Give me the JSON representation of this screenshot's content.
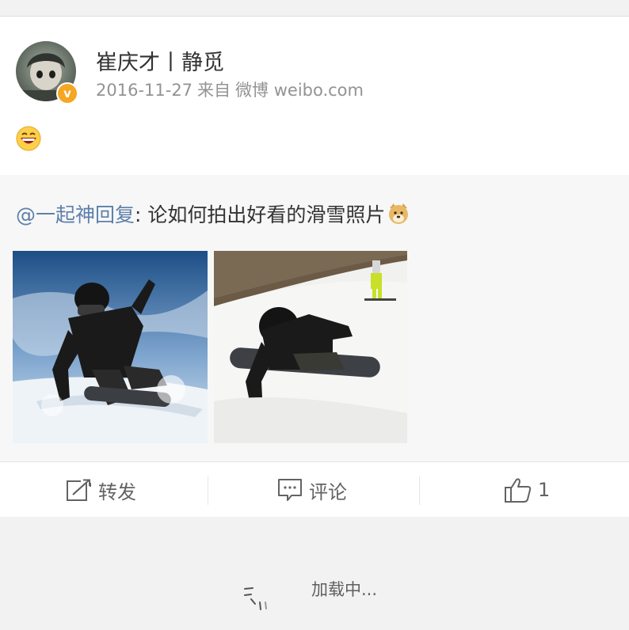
{
  "post": {
    "user_name": "崔庆才丨静觅",
    "date": "2016-11-27",
    "source_prefix": "来自",
    "source": "微博 weibo.com",
    "avatar": "avatar-icon",
    "verified_icon": "verified-v-icon",
    "verified_mark": "v",
    "content_emoji": "grinning-face-emoji"
  },
  "retweet": {
    "mention": "@一起神回复",
    "separator": ": ",
    "text": "论如何拍出好看的滑雪照片",
    "emoji": "doge-emoji",
    "images": [
      "snowboarder-photo-1",
      "snowboarder-photo-2"
    ]
  },
  "actions": {
    "repost_label": "转发",
    "comment_label": "评论",
    "like_count": "1",
    "repost_icon": "repost-icon",
    "comment_icon": "comment-icon",
    "like_icon": "thumbs-up-icon"
  },
  "loading": {
    "text": "加载中..."
  },
  "colors": {
    "link": "#5d80ab",
    "text": "#333333",
    "meta": "#939393",
    "verified": "#f5a623",
    "page_bg": "#f2f2f2",
    "retweet_bg": "#f7f7f7"
  }
}
